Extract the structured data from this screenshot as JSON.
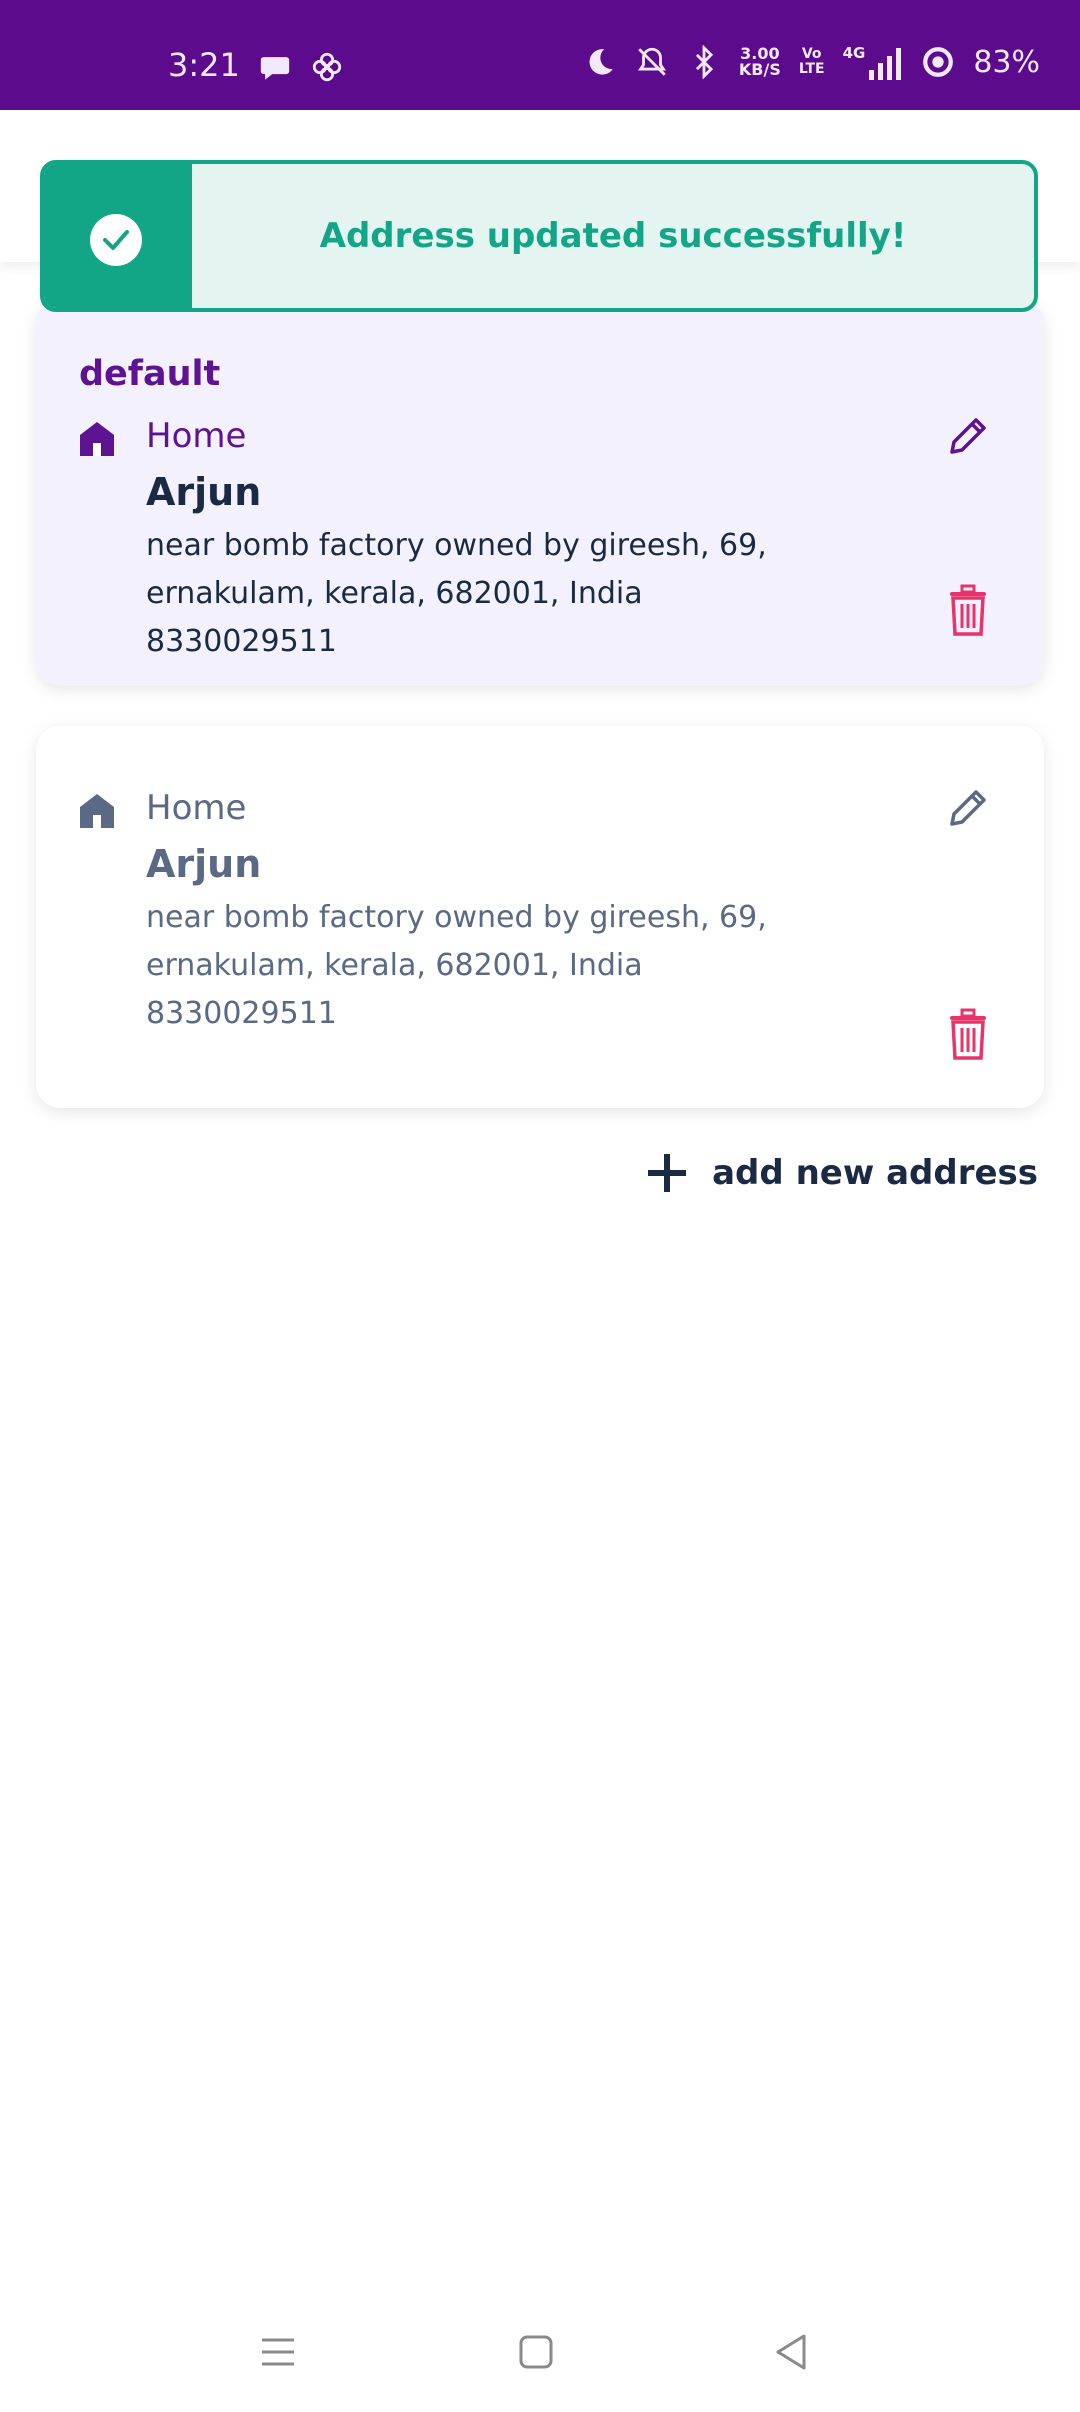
{
  "status_bar": {
    "time": "3:21",
    "net_speed_value": "3.00",
    "net_speed_unit": "KB/S",
    "volte_top": "Vo",
    "volte_bottom": "LTE",
    "network": "4G",
    "battery": "83%"
  },
  "toast": {
    "message": "Address updated successfully!",
    "color": "#12a586"
  },
  "addresses": [
    {
      "badge": "default",
      "type": "Home",
      "name": "Arjun",
      "line1": "near bomb factory owned by gireesh, 69,",
      "line2": "ernakulam, kerala, 682001, India",
      "phone": "8330029511"
    },
    {
      "type": "Home",
      "name": "Arjun",
      "line1": "near bomb factory owned by gireesh, 69,",
      "line2": "ernakulam, kerala, 682001, India",
      "phone": "8330029511"
    }
  ],
  "actions": {
    "add_address_label": "add new address"
  },
  "colors": {
    "brand": "#5c0b8c",
    "delete": "#e8336b",
    "success": "#12a586"
  }
}
